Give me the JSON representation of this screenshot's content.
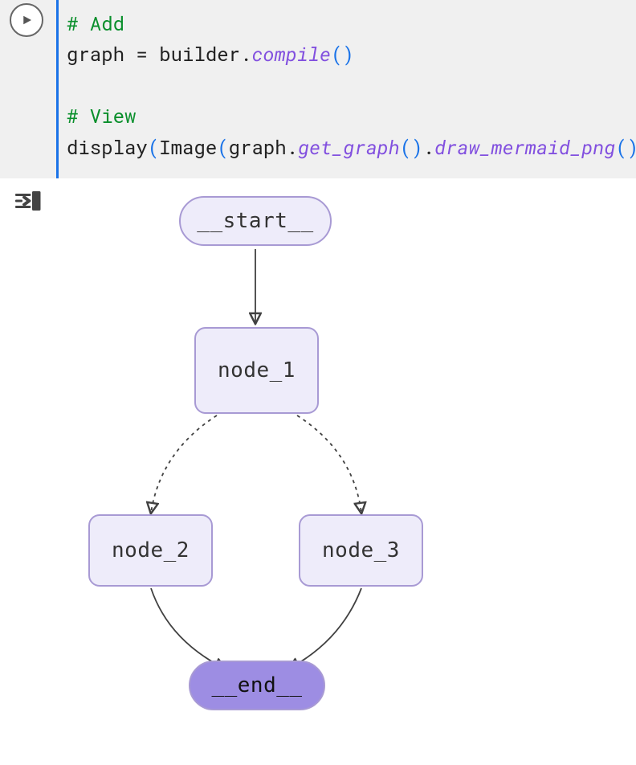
{
  "code": {
    "line1_comment": "# Add",
    "line2_var": "graph",
    "line2_eq": " = ",
    "line2_obj": "builder",
    "line2_dot": ".",
    "line2_meth": "compile",
    "line2_parens": "()",
    "line3_comment": "# View",
    "line4_fn": "display",
    "line4_open": "(",
    "line4_img": "Image",
    "line4_open2": "(",
    "line4_graph": "graph",
    "line4_dot": ".",
    "line4_gg": "get_graph",
    "line4_p1": "()",
    "line4_dot2": ".",
    "line4_dm": "draw_mermaid_png",
    "line4_p2": "()",
    "line4_close": ")"
  },
  "graph": {
    "start_label": "__start__",
    "node1_label": "node_1",
    "node2_label": "node_2",
    "node3_label": "node_3",
    "end_label": "__end__"
  }
}
